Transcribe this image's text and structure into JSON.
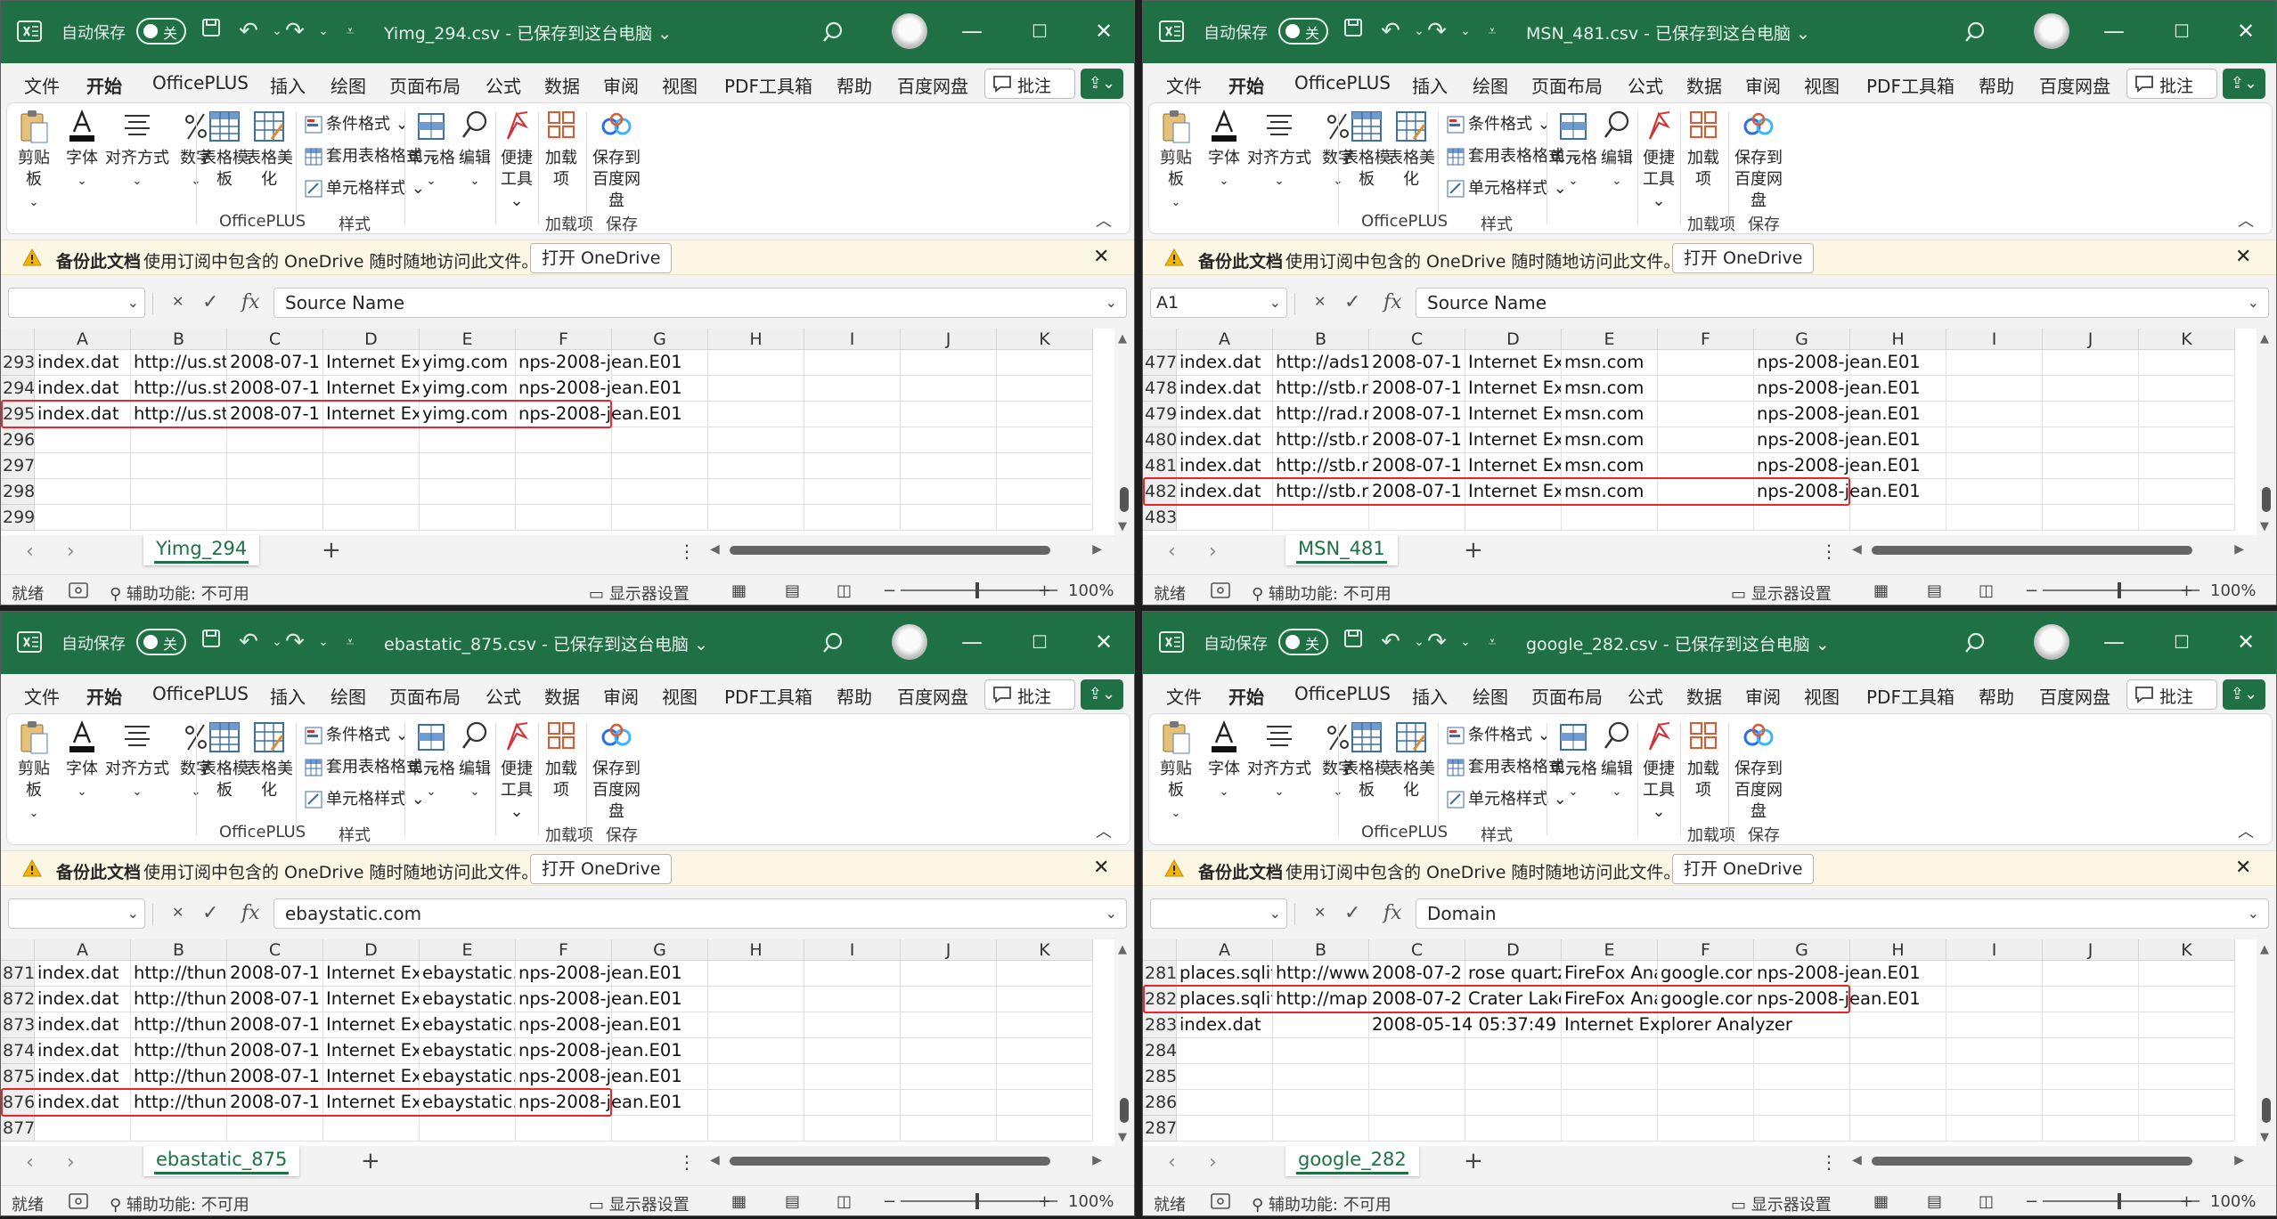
{
  "common": {
    "autosave_label": "自动保存",
    "autosave_state": "关",
    "saved_suffix": " - 已保存到这台电脑",
    "menu_tabs": [
      "文件",
      "开始",
      "OfficePLUS",
      "插入",
      "绘图",
      "页面布局",
      "公式",
      "数据",
      "审阅",
      "视图",
      "PDF工具箱",
      "帮助",
      "百度网盘"
    ],
    "comments_label": "批注",
    "ribbon": {
      "clipboard": "剪贴板",
      "font": "字体",
      "align": "对齐方式",
      "number": "数字",
      "table_template": "表格模板",
      "table_beautify": "表格美化",
      "cond_format": "条件格式",
      "table_format": "套用表格格式",
      "cell_style": "单元格样式",
      "cells": "单元格",
      "edit": "编辑",
      "quick_tools": "便捷工具",
      "addins": "加载项",
      "save_baidu": "保存到百度网盘",
      "group_officeplus": "OfficePLUS",
      "group_style": "样式",
      "group_addins": "加载项",
      "group_save": "保存"
    },
    "backup_title": "备份此文档",
    "backup_message": "使用订阅中包含的 OneDrive 随时随地访问此文件。",
    "open_onedrive": "打开 OneDrive",
    "status_ready": "就绪",
    "accessibility": "辅助功能: 不可用",
    "display_settings": "显示器设置",
    "zoom": "100%",
    "columns": [
      "A",
      "B",
      "C",
      "D",
      "E",
      "F",
      "G",
      "H",
      "I",
      "J",
      "K"
    ],
    "colors": {
      "excel_green": "#1F7145",
      "highlight_red": "#E8262B",
      "backup_bar": "#FCF7E4"
    }
  },
  "windows": [
    {
      "id": "yimg",
      "filename": "Yimg_294.csv",
      "name_box": "",
      "formula": "Source Name",
      "sheet_tab": "Yimg_294",
      "highlight_row": 295,
      "rows": [
        {
          "n": "293",
          "cells": [
            "index.dat",
            "http://us.st",
            "2008-07-1",
            "Internet Ex",
            "yimg.com",
            "nps-2008-jean.E01",
            "",
            "",
            "",
            "",
            ""
          ]
        },
        {
          "n": "294",
          "cells": [
            "index.dat",
            "http://us.st",
            "2008-07-1",
            "Internet Ex",
            "yimg.com",
            "nps-2008-jean.E01",
            "",
            "",
            "",
            "",
            ""
          ]
        },
        {
          "n": "295",
          "cells": [
            "index.dat",
            "http://us.st",
            "2008-07-1",
            "Internet Ex",
            "yimg.com",
            "nps-2008-jean.E01",
            "",
            "",
            "",
            "",
            ""
          ]
        },
        {
          "n": "296",
          "cells": [
            "",
            "",
            "",
            "",
            "",
            "",
            "",
            "",
            "",
            "",
            ""
          ]
        },
        {
          "n": "297",
          "cells": [
            "",
            "",
            "",
            "",
            "",
            "",
            "",
            "",
            "",
            "",
            ""
          ]
        },
        {
          "n": "298",
          "cells": [
            "",
            "",
            "",
            "",
            "",
            "",
            "",
            "",
            "",
            "",
            ""
          ]
        },
        {
          "n": "299",
          "cells": [
            "",
            "",
            "",
            "",
            "",
            "",
            "",
            "",
            "",
            "",
            ""
          ]
        }
      ]
    },
    {
      "id": "msn",
      "filename": "MSN_481.csv",
      "name_box": "A1",
      "formula": "Source Name",
      "sheet_tab": "MSN_481",
      "highlight_row": 482,
      "rows": [
        {
          "n": "477",
          "cells": [
            "index.dat",
            "http://ads1",
            "2008-07-1",
            "Internet Ex",
            "msn.com",
            "",
            "nps-2008-jean.E01",
            "",
            "",
            "",
            ""
          ]
        },
        {
          "n": "478",
          "cells": [
            "index.dat",
            "http://stb.n",
            "2008-07-1",
            "Internet Ex",
            "msn.com",
            "",
            "nps-2008-jean.E01",
            "",
            "",
            "",
            ""
          ]
        },
        {
          "n": "479",
          "cells": [
            "index.dat",
            "http://rad.r",
            "2008-07-1",
            "Internet Ex",
            "msn.com",
            "",
            "nps-2008-jean.E01",
            "",
            "",
            "",
            ""
          ]
        },
        {
          "n": "480",
          "cells": [
            "index.dat",
            "http://stb.n",
            "2008-07-1",
            "Internet Ex",
            "msn.com",
            "",
            "nps-2008-jean.E01",
            "",
            "",
            "",
            ""
          ]
        },
        {
          "n": "481",
          "cells": [
            "index.dat",
            "http://stb.n",
            "2008-07-1",
            "Internet Ex",
            "msn.com",
            "",
            "nps-2008-jean.E01",
            "",
            "",
            "",
            ""
          ]
        },
        {
          "n": "482",
          "cells": [
            "index.dat",
            "http://stb.n",
            "2008-07-1",
            "Internet Ex",
            "msn.com",
            "",
            "nps-2008-jean.E01",
            "",
            "",
            "",
            ""
          ]
        },
        {
          "n": "483",
          "cells": [
            "",
            "",
            "",
            "",
            "",
            "",
            "",
            "",
            "",
            "",
            ""
          ]
        }
      ]
    },
    {
      "id": "ebaystatic",
      "filename": "ebastatic_875.csv",
      "name_box": "",
      "formula": "ebaystatic.com",
      "sheet_tab": "ebastatic_875",
      "highlight_row": 876,
      "rows": [
        {
          "n": "871",
          "cells": [
            "index.dat",
            "http://thun",
            "2008-07-1",
            "Internet Ex",
            "ebaystatic.c",
            "nps-2008-jean.E01",
            "",
            "",
            "",
            "",
            ""
          ]
        },
        {
          "n": "872",
          "cells": [
            "index.dat",
            "http://thun",
            "2008-07-1",
            "Internet Ex",
            "ebaystatic.c",
            "nps-2008-jean.E01",
            "",
            "",
            "",
            "",
            ""
          ]
        },
        {
          "n": "873",
          "cells": [
            "index.dat",
            "http://thun",
            "2008-07-1",
            "Internet Ex",
            "ebaystatic.c",
            "nps-2008-jean.E01",
            "",
            "",
            "",
            "",
            ""
          ]
        },
        {
          "n": "874",
          "cells": [
            "index.dat",
            "http://thun",
            "2008-07-1",
            "Internet Ex",
            "ebaystatic.c",
            "nps-2008-jean.E01",
            "",
            "",
            "",
            "",
            ""
          ]
        },
        {
          "n": "875",
          "cells": [
            "index.dat",
            "http://thun",
            "2008-07-1",
            "Internet Ex",
            "ebaystatic.c",
            "nps-2008-jean.E01",
            "",
            "",
            "",
            "",
            ""
          ]
        },
        {
          "n": "876",
          "cells": [
            "index.dat",
            "http://thun",
            "2008-07-1",
            "Internet Ex",
            "ebaystatic.c",
            "nps-2008-jean.E01",
            "",
            "",
            "",
            "",
            ""
          ]
        },
        {
          "n": "877",
          "cells": [
            "",
            "",
            "",
            "",
            "",
            "",
            "",
            "",
            "",
            "",
            ""
          ]
        }
      ]
    },
    {
      "id": "google",
      "filename": "google_282.csv",
      "name_box": "",
      "formula": "Domain",
      "sheet_tab": "google_282",
      "highlight_row": 282,
      "rows": [
        {
          "n": "281",
          "cells": [
            "places.sqlit",
            "http://www",
            "2008-07-2",
            "rose quartz",
            "FireFox Ana",
            "google.cor",
            "nps-2008-jean.E01",
            "",
            "",
            "",
            ""
          ]
        },
        {
          "n": "282",
          "cells": [
            "places.sqlit",
            "http://map",
            "2008-07-2",
            "Crater Lake",
            "FireFox Ana",
            "google.cor",
            "nps-2008-jean.E01",
            "",
            "",
            "",
            ""
          ]
        },
        {
          "n": "283",
          "cells": [
            "index.dat",
            "",
            "2008-05-14 05:37:49",
            "",
            "Internet Explorer Analyzer",
            "",
            "",
            "",
            "",
            "",
            ""
          ]
        },
        {
          "n": "284",
          "cells": [
            "",
            "",
            "",
            "",
            "",
            "",
            "",
            "",
            "",
            "",
            ""
          ]
        },
        {
          "n": "285",
          "cells": [
            "",
            "",
            "",
            "",
            "",
            "",
            "",
            "",
            "",
            "",
            ""
          ]
        },
        {
          "n": "286",
          "cells": [
            "",
            "",
            "",
            "",
            "",
            "",
            "",
            "",
            "",
            "",
            ""
          ]
        },
        {
          "n": "287",
          "cells": [
            "",
            "",
            "",
            "",
            "",
            "",
            "",
            "",
            "",
            "",
            ""
          ]
        }
      ]
    }
  ]
}
